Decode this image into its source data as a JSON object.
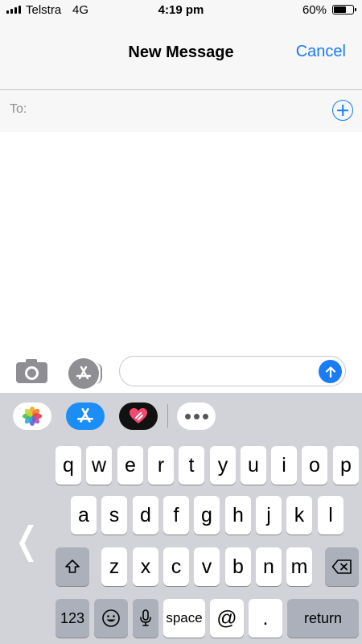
{
  "status_bar": {
    "carrier": "Telstra",
    "network": "4G",
    "time": "4:19 pm",
    "battery_percent": "60%",
    "battery_level": 0.6
  },
  "nav": {
    "title": "New Message",
    "cancel_label": "Cancel"
  },
  "to_field": {
    "label": "To:",
    "value": ""
  },
  "compose": {
    "message_value": "",
    "camera_icon": "camera-icon",
    "appstore_icon": "app-store-icon",
    "send_icon": "arrow-up-icon"
  },
  "app_drawer": {
    "items": [
      "photos-icon",
      "app-store-icon",
      "digital-touch-heart-icon",
      "more-icon"
    ]
  },
  "keyboard": {
    "row1": [
      "q",
      "w",
      "e",
      "r",
      "t",
      "y",
      "u",
      "i",
      "o",
      "p"
    ],
    "row2": [
      "a",
      "s",
      "d",
      "f",
      "g",
      "h",
      "j",
      "k",
      "l"
    ],
    "row3": [
      "z",
      "x",
      "c",
      "v",
      "b",
      "n",
      "m"
    ],
    "bottom": {
      "numbers_label": "123",
      "space_label": "space",
      "at_label": "@",
      "period_label": ".",
      "return_label": "return"
    }
  },
  "colors": {
    "accent": "#1a7cf5",
    "keyboard_bg": "#d1d3d9",
    "key_dark": "#abb0bb"
  }
}
